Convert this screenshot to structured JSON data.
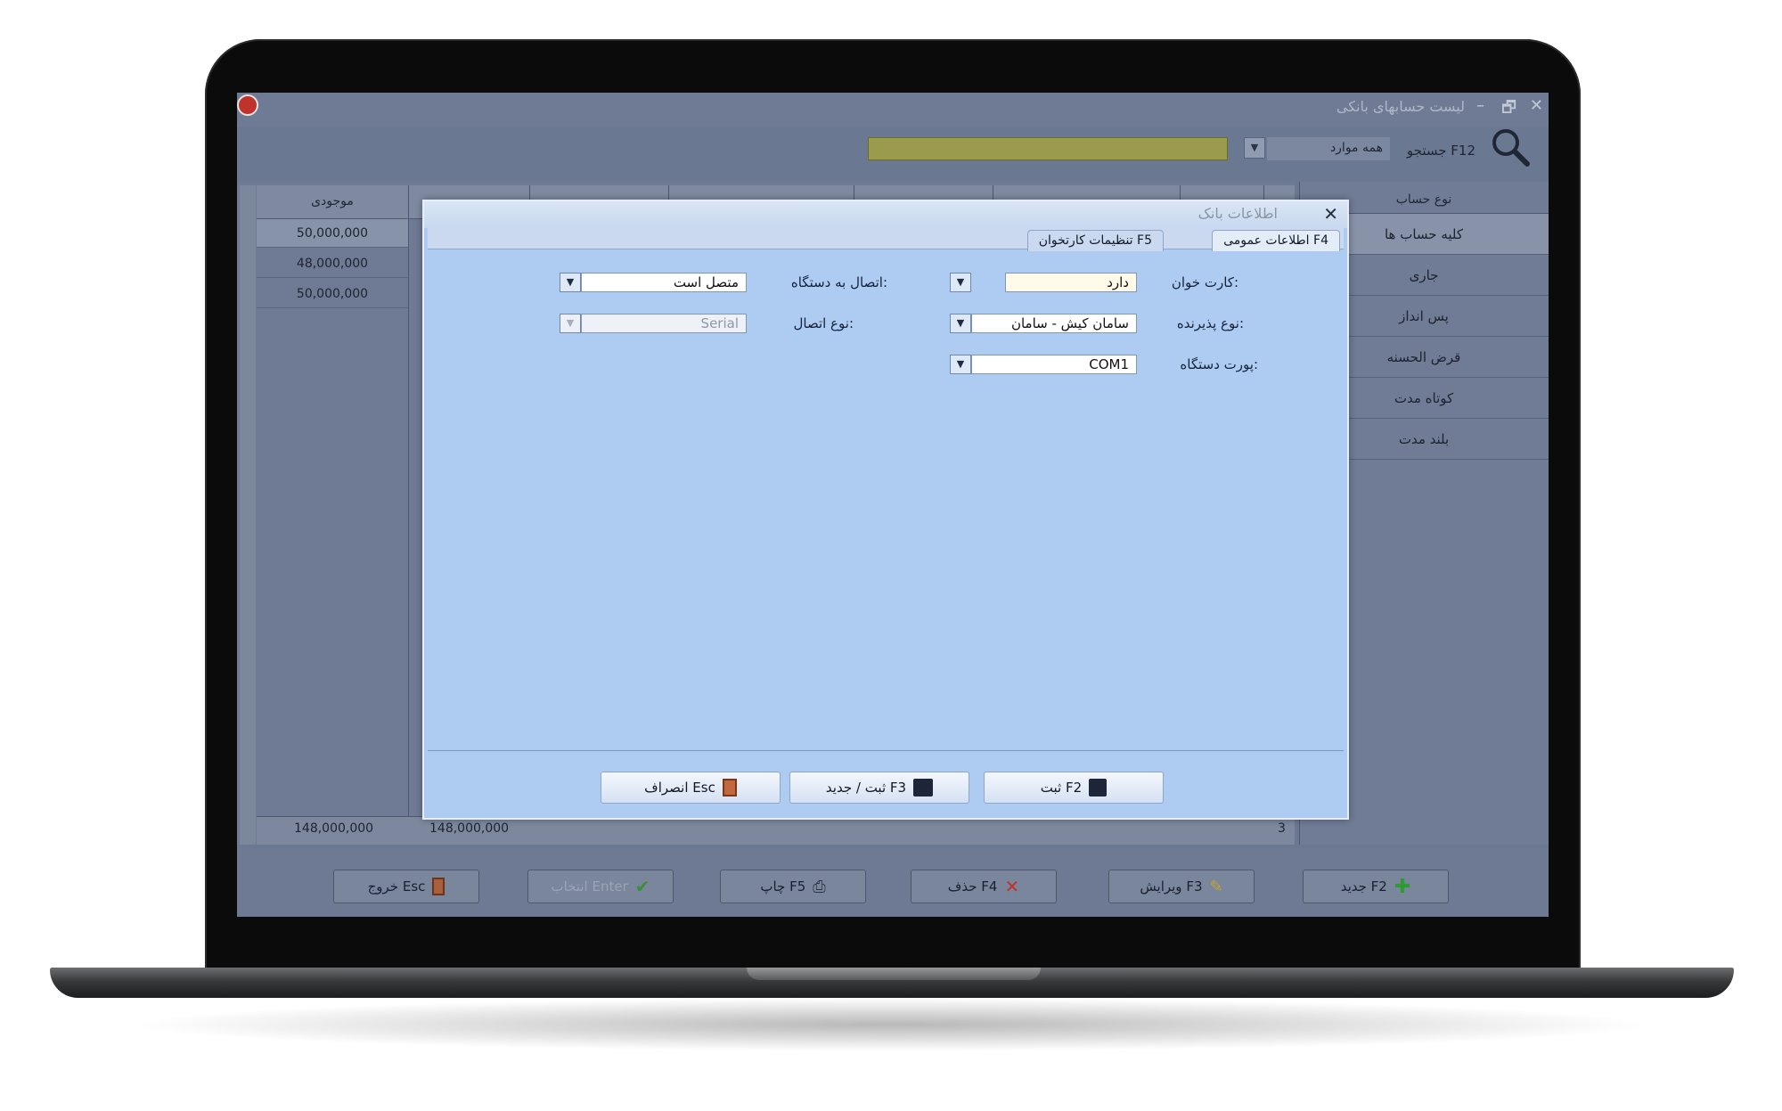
{
  "background_window": {
    "title": "لیست حسابهای بانکی",
    "window_controls": [
      "–",
      "🗗",
      "✕"
    ],
    "search": {
      "label": "جستجو F12",
      "scope": "همه موارد",
      "value": ""
    },
    "grid": {
      "balance_header": "موجودی",
      "balances": [
        "50,000,000",
        "48,000,000",
        "50,000,000"
      ],
      "footer": {
        "total_balance": "148,000,000",
        "total_2": "148,000,000",
        "count": "3"
      }
    },
    "account_types": {
      "header": "نوع حساب",
      "items": [
        "کلیه حساب ها",
        "جاری",
        "پس انداز",
        "قرض الحسنه",
        "کوتاه مدت",
        "بلند مدت"
      ]
    },
    "toolbar": {
      "new": "جدید F2",
      "edit": "ویرایش F3",
      "delete": "حذف F4",
      "print": "چاپ F5",
      "select": "انتخاب Enter",
      "exit": "خروج Esc"
    }
  },
  "dialog": {
    "title": "اطلاعات بانک",
    "tabs": [
      "اطلاعات عمومی F4",
      "تنظیمات کارتخوان F5"
    ],
    "fields": {
      "card_reader": {
        "label": "کارت خوان:",
        "value": "دارد"
      },
      "device_connection": {
        "label": "اتصال به دستگاه:",
        "value": "متصل است"
      },
      "acceptor_type": {
        "label": "نوع پذیرنده:",
        "value": "سامان کیش - سامان"
      },
      "connection_type": {
        "label": "نوع اتصال:",
        "value": "Serial"
      },
      "device_port": {
        "label": "پورت دستگاه:",
        "value": "COM1"
      }
    },
    "buttons": {
      "save": "ثبت F2",
      "save_new": "ثبت / جدید F3",
      "cancel": "انصراف Esc"
    }
  },
  "colors": {
    "dialog_bg": "#aecbf2",
    "overlay_bg": "#6b7891",
    "search_highlight": "#9a9b4c",
    "accent_red": "#c0332c",
    "accent_green": "#2f9a35"
  }
}
